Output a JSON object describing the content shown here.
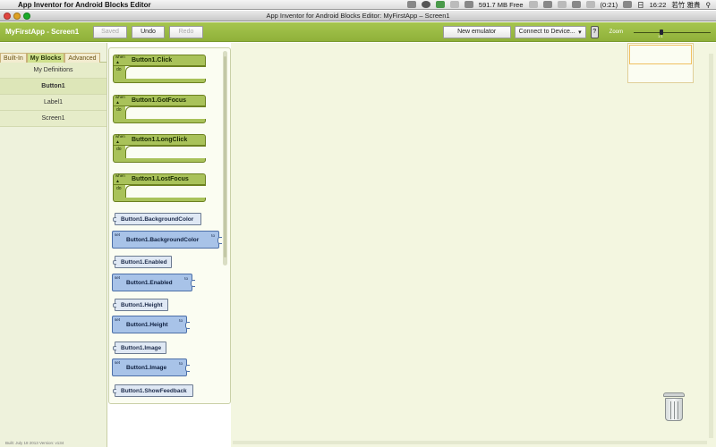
{
  "menubar": {
    "app_name": "App Inventor for Android Blocks Editor",
    "memory": "591.7 MB Free",
    "battery": "(0:21)",
    "day": "日",
    "time": "16:22",
    "user": "若竹 雅貴"
  },
  "window": {
    "title": "App Inventor for Android Blocks Editor: MyFirstApp – Screen1"
  },
  "toolbar": {
    "project": "MyFirstApp - Screen1",
    "saved_label": "Saved",
    "undo_label": "Undo",
    "redo_label": "Redo",
    "emulator_label": "New emulator",
    "connect_label": "Connect to Device...",
    "connect_arrow": "▾",
    "help_label": "?",
    "zoom_label": "Zoom",
    "zoom_tick": "1:1"
  },
  "sidebar": {
    "tabs": [
      "Built-In",
      "My Blocks",
      "Advanced"
    ],
    "active_tab": "My Blocks",
    "items": [
      "My Definitions",
      "Button1",
      "Label1",
      "Screen1"
    ],
    "selected_item": "Button1",
    "built_info": "Built: July 18 2013 Version: v134"
  },
  "blocks": {
    "when_label": "when",
    "do_label": "do",
    "set_label": "set",
    "to_label": "to",
    "events": [
      "Button1.Click",
      "Button1.GotFocus",
      "Button1.LongClick",
      "Button1.LostFocus"
    ],
    "getters": [
      "Button1.BackgroundColor",
      "Button1.Enabled",
      "Button1.Height",
      "Button1.Image",
      "Button1.ShowFeedback"
    ],
    "setters": [
      "Button1.BackgroundColor",
      "Button1.Enabled",
      "Button1.Height",
      "Button1.Image"
    ]
  },
  "colors": {
    "toolbar_green": "#9bba44",
    "event_block": "#a9c25a",
    "getter_block": "#dfe8f4",
    "setter_block": "#a8c3e8",
    "workspace": "#f3f6e0"
  }
}
